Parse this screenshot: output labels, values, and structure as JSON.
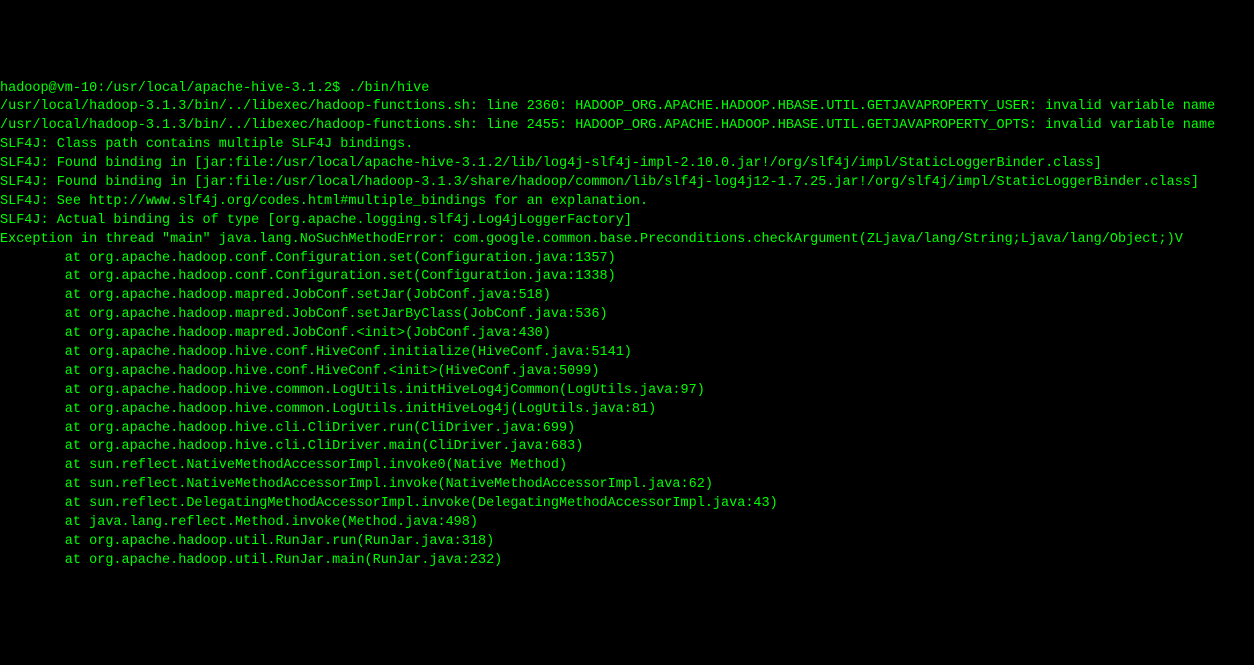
{
  "terminal": {
    "lines": [
      "hadoop@vm-10:/usr/local/apache-hive-3.1.2$ ./bin/hive",
      "/usr/local/hadoop-3.1.3/bin/../libexec/hadoop-functions.sh: line 2360: HADOOP_ORG.APACHE.HADOOP.HBASE.UTIL.GETJAVAPROPERTY_USER: invalid variable name",
      "/usr/local/hadoop-3.1.3/bin/../libexec/hadoop-functions.sh: line 2455: HADOOP_ORG.APACHE.HADOOP.HBASE.UTIL.GETJAVAPROPERTY_OPTS: invalid variable name",
      "SLF4J: Class path contains multiple SLF4J bindings.",
      "SLF4J: Found binding in [jar:file:/usr/local/apache-hive-3.1.2/lib/log4j-slf4j-impl-2.10.0.jar!/org/slf4j/impl/StaticLoggerBinder.class]",
      "SLF4J: Found binding in [jar:file:/usr/local/hadoop-3.1.3/share/hadoop/common/lib/slf4j-log4j12-1.7.25.jar!/org/slf4j/impl/StaticLoggerBinder.class]",
      "SLF4J: See http://www.slf4j.org/codes.html#multiple_bindings for an explanation.",
      "SLF4J: Actual binding is of type [org.apache.logging.slf4j.Log4jLoggerFactory]",
      "Exception in thread \"main\" java.lang.NoSuchMethodError: com.google.common.base.Preconditions.checkArgument(ZLjava/lang/String;Ljava/lang/Object;)V",
      "        at org.apache.hadoop.conf.Configuration.set(Configuration.java:1357)",
      "        at org.apache.hadoop.conf.Configuration.set(Configuration.java:1338)",
      "        at org.apache.hadoop.mapred.JobConf.setJar(JobConf.java:518)",
      "        at org.apache.hadoop.mapred.JobConf.setJarByClass(JobConf.java:536)",
      "        at org.apache.hadoop.mapred.JobConf.<init>(JobConf.java:430)",
      "        at org.apache.hadoop.hive.conf.HiveConf.initialize(HiveConf.java:5141)",
      "        at org.apache.hadoop.hive.conf.HiveConf.<init>(HiveConf.java:5099)",
      "        at org.apache.hadoop.hive.common.LogUtils.initHiveLog4jCommon(LogUtils.java:97)",
      "        at org.apache.hadoop.hive.common.LogUtils.initHiveLog4j(LogUtils.java:81)",
      "        at org.apache.hadoop.hive.cli.CliDriver.run(CliDriver.java:699)",
      "        at org.apache.hadoop.hive.cli.CliDriver.main(CliDriver.java:683)",
      "        at sun.reflect.NativeMethodAccessorImpl.invoke0(Native Method)",
      "        at sun.reflect.NativeMethodAccessorImpl.invoke(NativeMethodAccessorImpl.java:62)",
      "        at sun.reflect.DelegatingMethodAccessorImpl.invoke(DelegatingMethodAccessorImpl.java:43)",
      "        at java.lang.reflect.Method.invoke(Method.java:498)",
      "        at org.apache.hadoop.util.RunJar.run(RunJar.java:318)",
      "        at org.apache.hadoop.util.RunJar.main(RunJar.java:232)"
    ]
  }
}
